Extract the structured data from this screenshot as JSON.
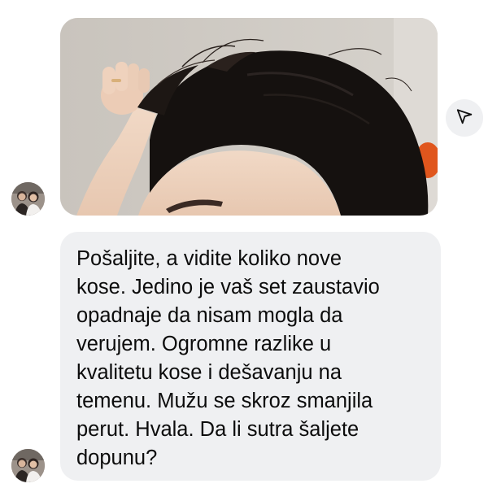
{
  "conversation": {
    "messages": [
      {
        "type": "image",
        "sender": "contact",
        "image_subject": "woman-parting-dark-hair-photo"
      },
      {
        "type": "text",
        "sender": "contact",
        "text": "Pošaljite, a vidite koliko nove\nkose.  Jedino je vaš set zaustavio\nopadnaje da nisam mogla da\nverujem. Ogromne razlike u\nkvalitetu kose i dešavanju na\ntemenu. Mužu se skroz smanjila\nperut. Hvala. Da li sutra šaljete\ndopunu?"
      }
    ],
    "share_icon": "paper-plane-icon",
    "colors": {
      "bubble_bg": "#eff0f2",
      "text": "#0c0c0c",
      "background": "#ffffff"
    }
  }
}
